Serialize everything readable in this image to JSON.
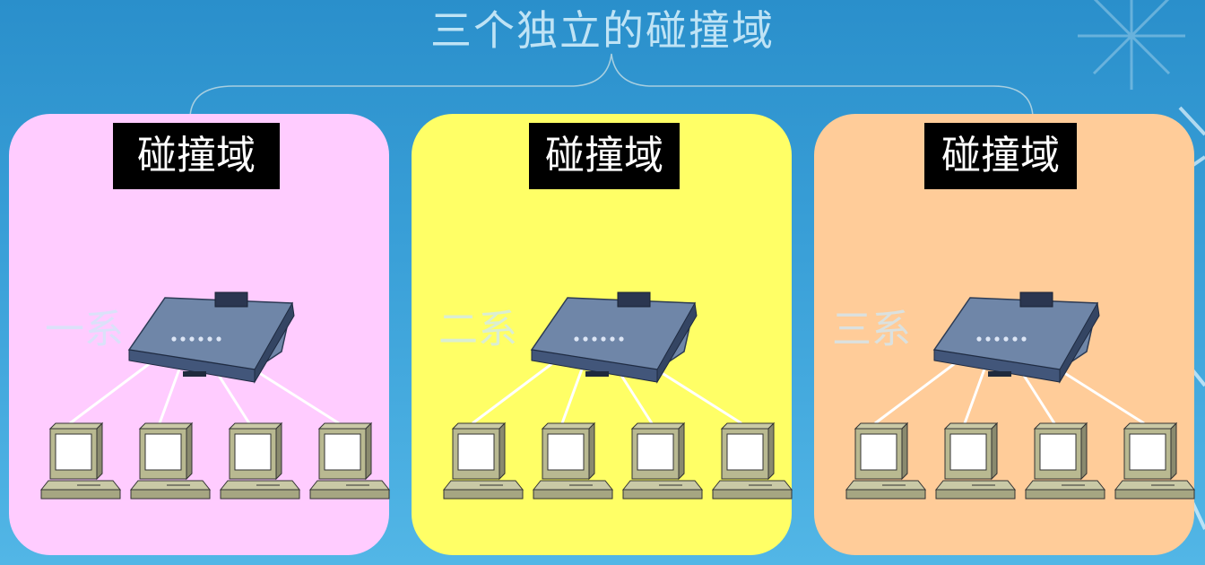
{
  "title": "三个独立的碰撞域",
  "domains": [
    {
      "label": "碰撞域",
      "dept": "一系",
      "color": "#ffccff"
    },
    {
      "label": "碰撞域",
      "dept": "二系",
      "color": "#ffff66"
    },
    {
      "label": "碰撞域",
      "dept": "三系",
      "color": "#ffcc99"
    }
  ]
}
